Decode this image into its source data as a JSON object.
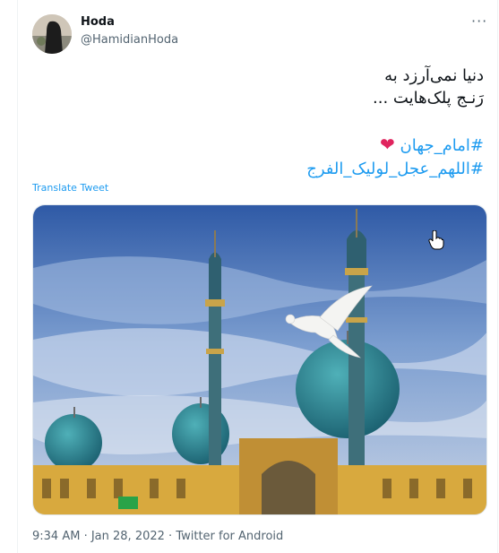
{
  "user": {
    "display_name": "Hoda",
    "handle": "@HamidianHoda"
  },
  "tweet": {
    "line1": "دنیا نمی‌آرزد به",
    "line2": "رَنـج پلک‌هایت ...",
    "hashtag1": "#امام_جهان",
    "hashtag1_emoji": "❤",
    "hashtag2": "#اللهم_عجل_لولیک_الفرج",
    "translate_label": "Translate Tweet"
  },
  "meta": {
    "time": "9:34 AM",
    "separator1": " · ",
    "date": "Jan 28, 2022",
    "separator2": " · ",
    "source": "Twitter for Android"
  },
  "icons": {
    "more": "more-options-icon",
    "cursor": "hand-pointer-icon"
  },
  "colors": {
    "link": "#1d9bf0",
    "secondary_text": "#536471",
    "heart": "#e0245e"
  }
}
